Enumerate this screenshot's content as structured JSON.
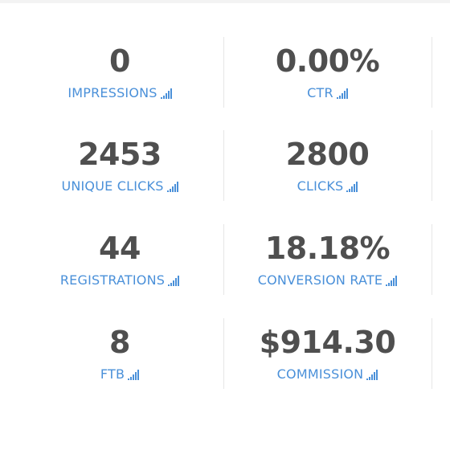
{
  "stats": [
    {
      "value": "0",
      "label": "IMPRESSIONS",
      "icon": "bar-chart-icon"
    },
    {
      "value": "0.00%",
      "label": "CTR",
      "icon": "bar-chart-icon"
    },
    {
      "value": "2453",
      "label": "UNIQUE CLICKS",
      "icon": "bar-chart-icon"
    },
    {
      "value": "2800",
      "label": "CLICKS",
      "icon": "bar-chart-icon"
    },
    {
      "value": "44",
      "label": "REGISTRATIONS",
      "icon": "bar-chart-icon"
    },
    {
      "value": "18.18%",
      "label": "CONVERSION RATE",
      "icon": "bar-chart-icon"
    },
    {
      "value": "8",
      "label": "FTB",
      "icon": "bar-chart-icon"
    },
    {
      "value": "$914.30",
      "label": "COMMISSION",
      "icon": "bar-chart-icon"
    }
  ],
  "colors": {
    "value_text": "#4f4f4f",
    "label_text": "#4a90d9",
    "divider": "#e6e6e6"
  }
}
